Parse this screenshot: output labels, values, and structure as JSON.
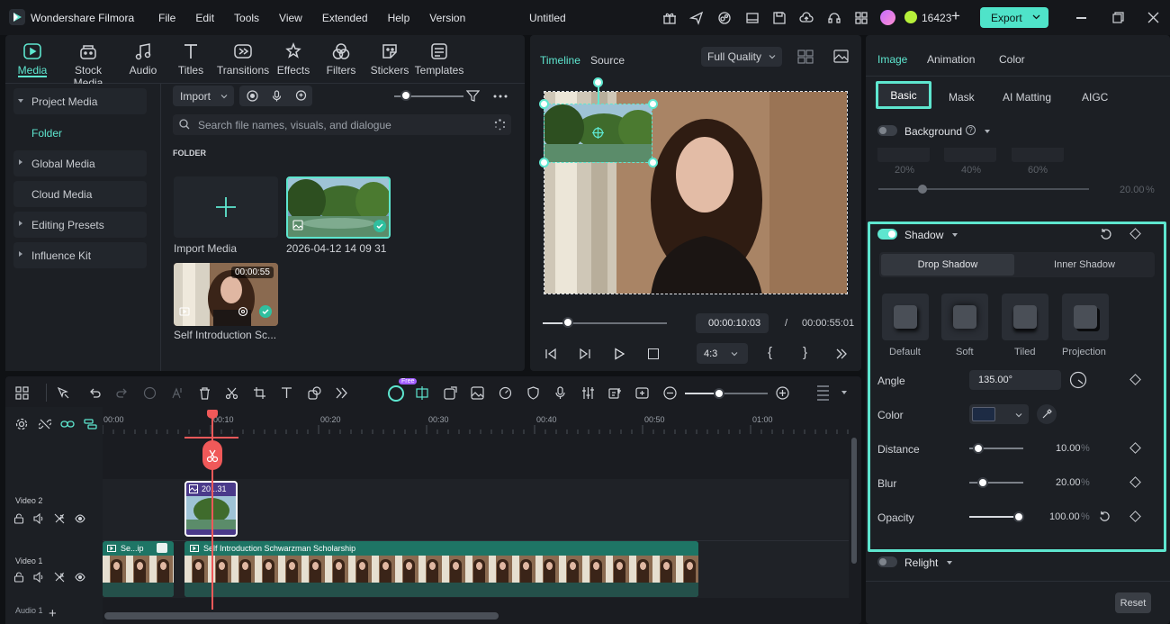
{
  "app": {
    "name": "Wondershare Filmora",
    "project_title": "Untitled",
    "credits": "16423"
  },
  "menu": [
    "File",
    "Edit",
    "Tools",
    "View",
    "Extended",
    "Help",
    "Version"
  ],
  "export_label": "Export",
  "tools": [
    {
      "label": "Media",
      "icon": "media-icon"
    },
    {
      "label": "Stock Media",
      "icon": "stock-media-icon"
    },
    {
      "label": "Audio",
      "icon": "audio-icon"
    },
    {
      "label": "Titles",
      "icon": "titles-icon"
    },
    {
      "label": "Transitions",
      "icon": "transitions-icon"
    },
    {
      "label": "Effects",
      "icon": "effects-icon"
    },
    {
      "label": "Filters",
      "icon": "filters-icon"
    },
    {
      "label": "Stickers",
      "icon": "stickers-icon"
    },
    {
      "label": "Templates",
      "icon": "templates-icon"
    }
  ],
  "sidebar": {
    "project_media": "Project Media",
    "folder": "Folder",
    "global_media": "Global Media",
    "cloud_media": "Cloud Media",
    "editing_presets": "Editing Presets",
    "influence_kit": "Influence Kit"
  },
  "media": {
    "import_label": "Import",
    "search_placeholder": "Search file names, visuals, and dialogue",
    "folder_heading": "FOLDER",
    "import_media": "Import Media",
    "item1_name": "2026-04-12 14 09 31",
    "item2_name": "Self Introduction Sc...",
    "item2_duration": "00:00:55"
  },
  "preview": {
    "tab_timeline": "Timeline",
    "tab_source": "Source",
    "quality": "Full Quality",
    "current_time": "00:00:10:03",
    "separator": "/",
    "total_time": "00:00:55:01",
    "aspect": "4:3",
    "bracket_in": "{",
    "bracket_out": "}"
  },
  "timeline": {
    "ruler": [
      "00:00",
      "00:10",
      "00:20",
      "00:30",
      "00:40",
      "00:50",
      "01:00"
    ],
    "video2": "Video 2",
    "video1": "Video 1",
    "audio1": "Audio 1",
    "clip_v2": "20...31",
    "clip_v1a": "Se...ip",
    "clip_v1b": "Self Introduction Schwarzman Scholarship",
    "ai_badge": "Free"
  },
  "props": {
    "tabs": [
      "Image",
      "Animation",
      "Color"
    ],
    "subtabs": [
      "Basic",
      "Mask",
      "AI Matting",
      "AIGC"
    ],
    "background": "Background",
    "bg_presets": [
      "20%",
      "40%",
      "60%"
    ],
    "bg_value": "20.00",
    "bg_unit": "%",
    "shadow": "Shadow",
    "drop_shadow": "Drop Shadow",
    "inner_shadow": "Inner Shadow",
    "shadow_types": [
      "Default",
      "Soft",
      "Tiled",
      "Projection"
    ],
    "angle_label": "Angle",
    "angle_value": "135.00°",
    "color_label": "Color",
    "shadow_color": "#1d2b44",
    "distance_label": "Distance",
    "distance_value": "10.00",
    "blur_label": "Blur",
    "blur_value": "20.00",
    "opacity_label": "Opacity",
    "opacity_value": "100.00",
    "unit": "%",
    "relight": "Relight",
    "reset": "Reset"
  },
  "colors": {
    "accent": "#5ee6cf",
    "export_bg": "#4fe3c9",
    "clip_green": "#1e7565",
    "clip_purple": "#4a3a8a",
    "playhead": "#f05959"
  }
}
